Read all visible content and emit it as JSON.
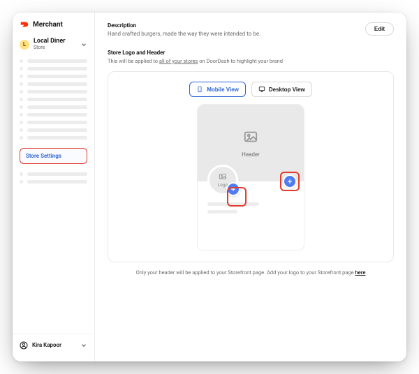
{
  "brand": {
    "name": "Merchant"
  },
  "store": {
    "initial": "L",
    "name": "Local Diner",
    "type": "Store"
  },
  "sidebar": {
    "active_item_label": "Store Settings"
  },
  "user": {
    "name": "Kira Kapoor"
  },
  "description": {
    "label": "Description",
    "text": "Hand crafted burgers, made the way they were intended to be.",
    "edit_label": "Edit"
  },
  "logo_header": {
    "title": "Store Logo and Header",
    "sub_pre": "This will be applied to ",
    "sub_link": "all of your stores",
    "sub_post": " on DoorDash to highlight your brand"
  },
  "toggle": {
    "mobile": "Mobile View",
    "desktop": "Desktop View"
  },
  "preview": {
    "header_label": "Header",
    "logo_label": "Logo"
  },
  "footnote": {
    "text": "Only your header will be applied to your Storefront page. Add your logo to your Storefront page ",
    "link": "here"
  },
  "colors": {
    "accent_red": "#e33b2e",
    "accent_blue": "#4f7cf0",
    "link_blue": "#2a62d6"
  }
}
